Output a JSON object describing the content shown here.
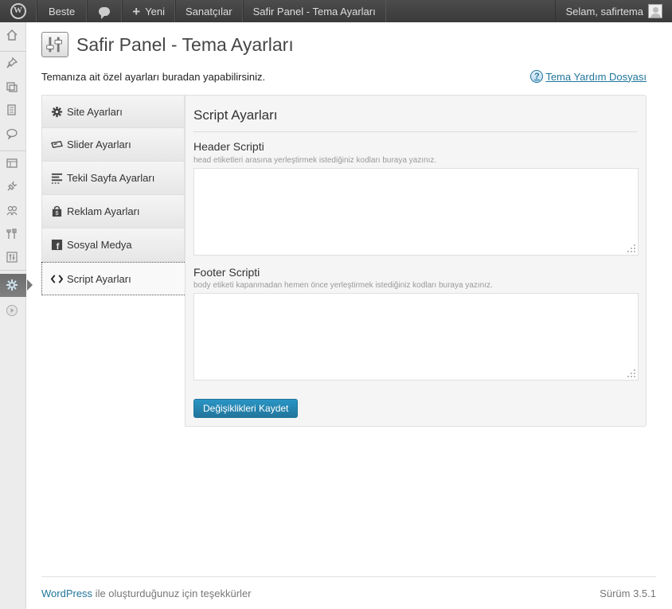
{
  "adminbar": {
    "site_name": "Beste",
    "new_label": "Yeni",
    "artists_label": "Sanatçılar",
    "page_label": "Safir Panel - Tema Ayarları",
    "greeting": "Selam, safirtema"
  },
  "page": {
    "title": "Safir Panel - Tema Ayarları",
    "description": "Temanıza ait özel ayarları buradan yapabilirsiniz.",
    "help_link": "Tema Yardım Dosyası",
    "help_icon": "?"
  },
  "tabs": [
    {
      "label": "Site Ayarları",
      "icon": "gear-icon"
    },
    {
      "label": "Slider Ayarları",
      "icon": "slider-icon"
    },
    {
      "label": "Tekil Sayfa Ayarları",
      "icon": "lines-icon"
    },
    {
      "label": "Reklam Ayarları",
      "icon": "bag-icon"
    },
    {
      "label": "Sosyal Medya",
      "icon": "facebook-icon"
    },
    {
      "label": "Script Ayarları",
      "icon": "code-icon",
      "active": true
    }
  ],
  "panel": {
    "title": "Script Ayarları",
    "header_label": "Header Scripti",
    "header_desc": "head etiketleri arasına yerleştirmek istediğiniz kodları buraya yazınız.",
    "header_value": "",
    "footer_label": "Footer Scripti",
    "footer_desc": "body etiketi kapanmadan hemen önce yerleştirmek istediğiniz kodları buraya yazınız.",
    "footer_value": "",
    "save_label": "Değişiklikleri Kaydet"
  },
  "footer": {
    "wordpress_link": "WordPress",
    "thanks_text": " ile oluşturduğunuz için teşekkürler",
    "version": "Sürüm 3.5.1"
  },
  "colors": {
    "link": "#21759b",
    "adminbar": "#464646",
    "button": "#21759b"
  }
}
